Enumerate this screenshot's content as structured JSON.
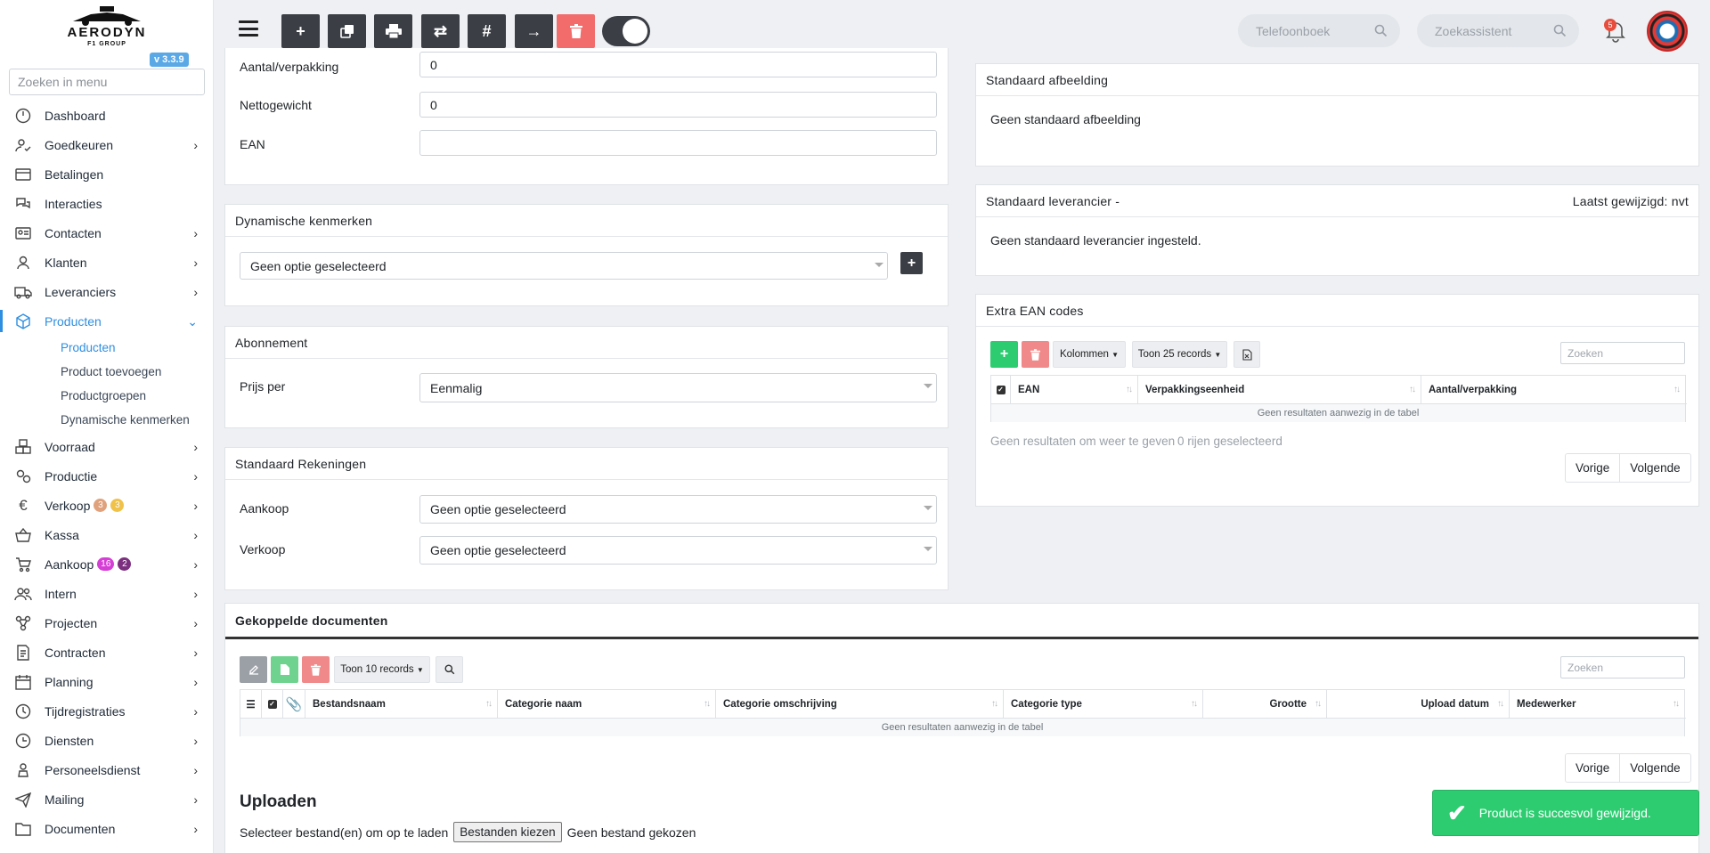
{
  "sidebar": {
    "logo_text": "AERODYN",
    "logo_sub": "F1 GROUP",
    "version": "v 3.3.9",
    "search_placeholder": "Zoeken in menu",
    "items": [
      {
        "label": "Dashboard"
      },
      {
        "label": "Goedkeuren"
      },
      {
        "label": "Betalingen"
      },
      {
        "label": "Interacties"
      },
      {
        "label": "Contacten"
      },
      {
        "label": "Klanten"
      },
      {
        "label": "Leveranciers"
      },
      {
        "label": "Producten"
      },
      {
        "label": "Voorraad"
      },
      {
        "label": "Productie"
      },
      {
        "label": "Verkoop",
        "badges": [
          "3",
          "3"
        ]
      },
      {
        "label": "Kassa"
      },
      {
        "label": "Aankoop",
        "badges": [
          "16",
          "2"
        ]
      },
      {
        "label": "Intern"
      },
      {
        "label": "Projecten"
      },
      {
        "label": "Contracten"
      },
      {
        "label": "Planning"
      },
      {
        "label": "Tijdregistraties"
      },
      {
        "label": "Diensten"
      },
      {
        "label": "Personeelsdienst"
      },
      {
        "label": "Mailing"
      },
      {
        "label": "Documenten"
      }
    ],
    "sub_items": [
      "Producten",
      "Product toevoegen",
      "Productgroepen",
      "Dynamische kenmerken"
    ]
  },
  "topbar": {
    "phonebook_placeholder": "Telefoonboek",
    "assistant_placeholder": "Zoekassistent",
    "notification_count": "5"
  },
  "form": {
    "aantal_label": "Aantal/verpakking",
    "aantal_value": "0",
    "netto_label": "Nettogewicht",
    "netto_value": "0",
    "ean_label": "EAN",
    "ean_value": ""
  },
  "dynamic": {
    "title": "Dynamische kenmerken",
    "select_value": "Geen optie geselecteerd"
  },
  "subscription": {
    "title": "Abonnement",
    "label": "Prijs per",
    "value": "Eenmalig"
  },
  "accounts": {
    "title": "Standaard Rekeningen",
    "purchase_label": "Aankoop",
    "purchase_value": "Geen optie geselecteerd",
    "sales_label": "Verkoop",
    "sales_value": "Geen optie geselecteerd"
  },
  "image_card": {
    "title": "Standaard afbeelding",
    "body": "Geen standaard afbeelding"
  },
  "supplier_card": {
    "title": "Standaard leverancier -",
    "modified": "Laatst gewijzigd: nvt",
    "body": "Geen standaard leverancier ingesteld."
  },
  "ean_card": {
    "title": "Extra EAN codes",
    "columns_label": "Kolommen",
    "records_label": "Toon 25 records",
    "search_placeholder": "Zoeken",
    "headers": [
      "EAN",
      "Verpakkingseenheid",
      "Aantal/verpakking"
    ],
    "empty": "Geen resultaten aanwezig in de tabel",
    "info": "Geen resultaten om weer te geven",
    "selected": "0 rijen geselecteerd",
    "prev": "Vorige",
    "next": "Volgende"
  },
  "docs": {
    "title": "Gekoppelde documenten",
    "records_label": "Toon 10 records",
    "search_placeholder": "Zoeken",
    "headers": [
      "Bestandsnaam",
      "Categorie naam",
      "Categorie omschrijving",
      "Categorie type",
      "Grootte",
      "Upload datum",
      "Medewerker"
    ],
    "empty": "Geen resultaten aanwezig in de tabel",
    "prev": "Vorige",
    "next": "Volgende",
    "upload_title": "Uploaden",
    "upload_text": "Selecteer bestand(en) om op te laden",
    "choose_label": "Bestanden kiezen",
    "no_file": "Geen bestand gekozen"
  },
  "toast": {
    "message": "Product is succesvol gewijzigd."
  }
}
